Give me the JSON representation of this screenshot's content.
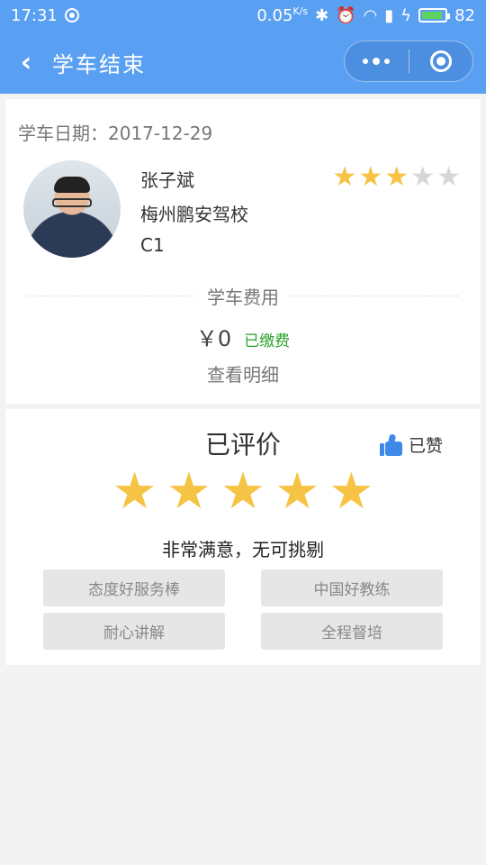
{
  "status_bar": {
    "time": "17:31",
    "net_speed": "0.05",
    "net_speed_unit": "K/s",
    "battery_level": "82"
  },
  "nav": {
    "title": "学车结束",
    "back_icon": "chevron-left-icon",
    "menu_icon": "more-dots-icon",
    "close_icon": "target-circle-icon"
  },
  "lesson": {
    "date_label": "学车日期：2017-12-29",
    "coach_name": "张子斌",
    "school": "梅州鹏安驾校",
    "license_type": "C1",
    "coach_rating": 3,
    "coach_rating_max": 5,
    "fee_title": "学车费用",
    "fee_amount": "￥0",
    "fee_status": "已缴费",
    "detail_link": "查看明细"
  },
  "review": {
    "title": "已评价",
    "like_label": "已赞",
    "like_icon": "thumbs-up-icon",
    "rating": 5,
    "rating_max": 5,
    "rating_text": "非常满意，无可挑剔",
    "tags": [
      "态度好服务棒",
      "中国好教练",
      "耐心讲解",
      "全程督培"
    ]
  },
  "colors": {
    "accent": "#5aa0f2",
    "star_on": "#f6c344",
    "star_off": "#d7d7d7",
    "paid_green": "#2aa32a",
    "like_blue": "#3f8ae8"
  }
}
